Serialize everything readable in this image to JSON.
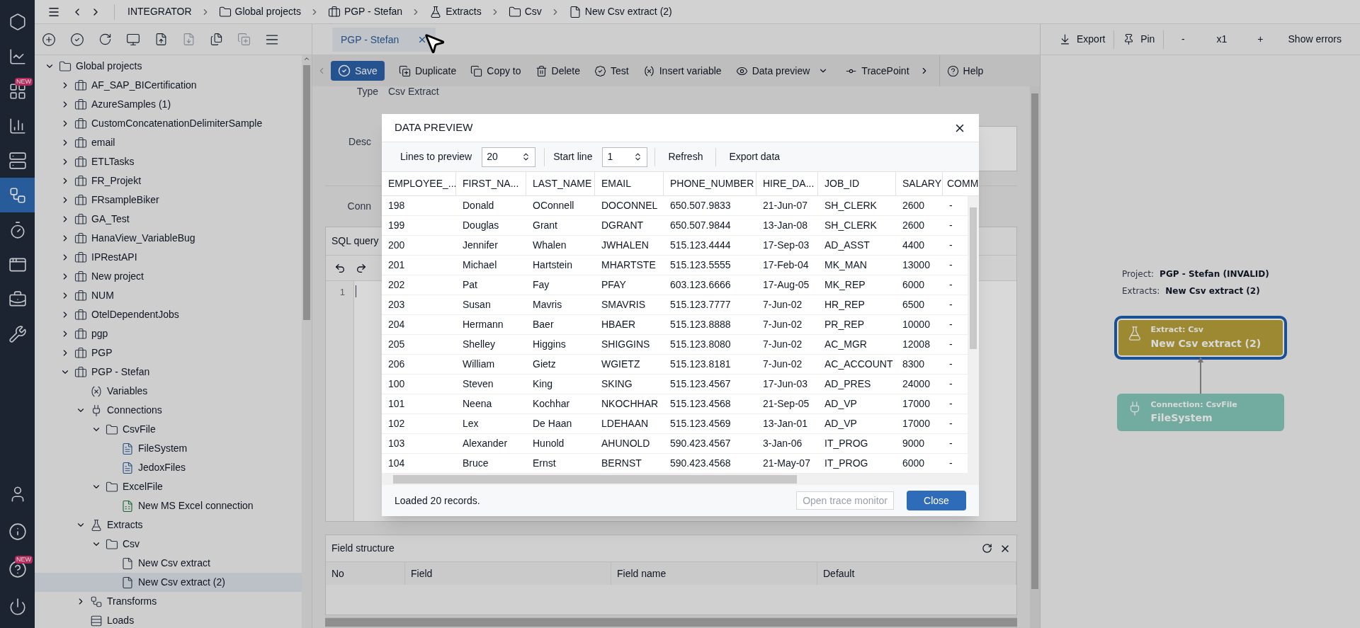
{
  "nav_rail": [
    {
      "selected": false
    },
    {
      "selected": false
    },
    {
      "selected": false,
      "badge": "NEW"
    },
    {
      "selected": false
    },
    {
      "selected": false
    },
    {
      "selected": true
    },
    {
      "selected": false
    },
    {
      "selected": false
    },
    {
      "selected": false
    },
    {
      "selected": false
    }
  ],
  "nav_rail_bottom": [
    {
      "selected": false
    },
    {
      "selected": false
    },
    {
      "selected": false,
      "badge": "NEW"
    },
    {
      "selected": false
    }
  ],
  "breadcrumb": [
    {
      "label": "INTEGRATOR",
      "kind": "root"
    },
    {
      "label": "Global projects",
      "kind": "folder"
    },
    {
      "label": "PGP - Stefan",
      "kind": "project"
    },
    {
      "label": "Extracts",
      "kind": "extracts"
    },
    {
      "label": "Csv",
      "kind": "folder"
    },
    {
      "label": "New Csv extract (2)",
      "kind": "file"
    }
  ],
  "tabs": [
    {
      "label": "PGP - Stefan",
      "selected": true
    }
  ],
  "editor_toolbar": [
    {
      "label": "Save",
      "kind": "save"
    },
    {
      "label": "Duplicate",
      "kind": "duplicate"
    },
    {
      "label": "Copy to",
      "kind": "copy"
    },
    {
      "label": "Delete",
      "kind": "delete"
    },
    {
      "label": "Test",
      "kind": "test"
    },
    {
      "label": "Insert variable",
      "kind": "variable"
    },
    {
      "label": "Data preview",
      "kind": "preview"
    },
    {
      "label": "TracePoint",
      "kind": "trace"
    },
    {
      "label": "Help",
      "kind": "help"
    }
  ],
  "graph_toolbar": [
    {
      "label": "Export",
      "kind": "export"
    },
    {
      "label": "Pin",
      "kind": "pin"
    },
    {
      "label": "-",
      "kind": "zoom"
    },
    {
      "label": "x1",
      "kind": "zoom"
    },
    {
      "label": "+",
      "kind": "zoom"
    },
    {
      "label": "Show errors",
      "kind": "plain"
    }
  ],
  "tree": [
    {
      "label": "Global projects",
      "kind": "folder",
      "expanded": true,
      "selected": false,
      "children": [
        {
          "label": "AF_SAP_BICertification",
          "kind": "project",
          "expanded": false,
          "selected": false
        },
        {
          "label": "AzureSamples (1)",
          "kind": "project",
          "expanded": false,
          "selected": false
        },
        {
          "label": "CustomConcatenationDelimiterSample",
          "kind": "project",
          "expanded": false,
          "selected": false
        },
        {
          "label": "email",
          "kind": "project",
          "expanded": false,
          "selected": false
        },
        {
          "label": "ETLTasks",
          "kind": "project",
          "expanded": false,
          "selected": false
        },
        {
          "label": "FR_Projekt",
          "kind": "project",
          "expanded": false,
          "selected": false
        },
        {
          "label": "FRsampleBiker",
          "kind": "project",
          "expanded": false,
          "selected": false
        },
        {
          "label": "GA_Test",
          "kind": "project",
          "expanded": false,
          "selected": false
        },
        {
          "label": "HanaView_VariableBug",
          "kind": "project",
          "expanded": false,
          "selected": false
        },
        {
          "label": "IPRestAPI",
          "kind": "project",
          "expanded": false,
          "selected": false
        },
        {
          "label": "New project",
          "kind": "project",
          "expanded": false,
          "selected": false
        },
        {
          "label": "NUM",
          "kind": "project",
          "expanded": false,
          "selected": false
        },
        {
          "label": "OtelDependentJobs",
          "kind": "project",
          "expanded": false,
          "selected": false
        },
        {
          "label": "pgp",
          "kind": "project",
          "expanded": false,
          "selected": false
        },
        {
          "label": "PGP",
          "kind": "project",
          "expanded": false,
          "selected": false
        },
        {
          "label": "PGP - Stefan",
          "kind": "project",
          "expanded": true,
          "selected": false,
          "children": [
            {
              "label": "Variables",
              "kind": "variables",
              "selected": false
            },
            {
              "label": "Connections",
              "kind": "connections",
              "expanded": true,
              "selected": false,
              "children": [
                {
                  "label": "CsvFile",
                  "kind": "folder",
                  "expanded": true,
                  "selected": false,
                  "children": [
                    {
                      "label": "FileSystem",
                      "kind": "csv",
                      "selected": false
                    },
                    {
                      "label": "JedoxFiles",
                      "kind": "csv",
                      "selected": false
                    }
                  ]
                },
                {
                  "label": "ExcelFile",
                  "kind": "folder",
                  "expanded": true,
                  "selected": false,
                  "children": [
                    {
                      "label": "New MS Excel connection",
                      "kind": "excel",
                      "selected": false
                    }
                  ]
                }
              ]
            },
            {
              "label": "Extracts",
              "kind": "extracts",
              "expanded": true,
              "selected": false,
              "children": [
                {
                  "label": "Csv",
                  "kind": "folder",
                  "expanded": true,
                  "selected": false,
                  "children": [
                    {
                      "label": "New Csv extract",
                      "kind": "file",
                      "selected": false
                    },
                    {
                      "label": "New Csv extract (2)",
                      "kind": "file",
                      "selected": true
                    }
                  ]
                }
              ]
            },
            {
              "label": "Transforms",
              "kind": "transforms",
              "expanded": false,
              "selected": false
            },
            {
              "label": "Loads",
              "kind": "loads",
              "selected": false
            }
          ]
        }
      ]
    }
  ],
  "form": {
    "type_label": "Type",
    "type_value": "Csv Extract",
    "description_label": "Desc",
    "connection_label": "Conn"
  },
  "sql_query": {
    "title": "SQL query",
    "line_numbers": [
      "1"
    ]
  },
  "field_structure": {
    "title": "Field structure",
    "columns": [
      "No",
      "Field",
      "Field name",
      "Default"
    ]
  },
  "graph": {
    "project_label": "Project:",
    "project_value": "PGP - Stefan (INVALID)",
    "extracts_label": "Extracts:",
    "extracts_value": "New Csv extract (2)",
    "nodes": [
      {
        "kind": "extract",
        "caption": "Extract: Csv",
        "name": "New Csv extract (2)",
        "selected": true
      },
      {
        "kind": "connection",
        "caption": "Connection: CsvFile",
        "name": "FileSystem",
        "selected": false
      }
    ]
  },
  "dialog": {
    "title": "DATA PREVIEW",
    "lines_label": "Lines to preview",
    "lines_value": "20",
    "start_label": "Start line",
    "start_value": "1",
    "refresh": "Refresh",
    "export": "Export data",
    "columns": [
      "EMPLOYEE_...",
      "FIRST_NA...",
      "LAST_NAME",
      "EMAIL",
      "PHONE_NUMBER",
      "HIRE_DA...",
      "JOB_ID",
      "SALARY",
      "COMM"
    ],
    "rows": [
      [
        "198",
        "Donald",
        "OConnell",
        "DOCONNEL",
        "650.507.9833",
        "21-Jun-07",
        "SH_CLERK",
        "2600",
        "-"
      ],
      [
        "199",
        "Douglas",
        "Grant",
        "DGRANT",
        "650.507.9844",
        "13-Jan-08",
        "SH_CLERK",
        "2600",
        "-"
      ],
      [
        "200",
        "Jennifer",
        "Whalen",
        "JWHALEN",
        "515.123.4444",
        "17-Sep-03",
        "AD_ASST",
        "4400",
        "-"
      ],
      [
        "201",
        "Michael",
        "Hartstein",
        "MHARTSTE",
        "515.123.5555",
        "17-Feb-04",
        "MK_MAN",
        "13000",
        "-"
      ],
      [
        "202",
        "Pat",
        "Fay",
        "PFAY",
        "603.123.6666",
        "17-Aug-05",
        "MK_REP",
        "6000",
        "-"
      ],
      [
        "203",
        "Susan",
        "Mavris",
        "SMAVRIS",
        "515.123.7777",
        "7-Jun-02",
        "HR_REP",
        "6500",
        "-"
      ],
      [
        "204",
        "Hermann",
        "Baer",
        "HBAER",
        "515.123.8888",
        "7-Jun-02",
        "PR_REP",
        "10000",
        "-"
      ],
      [
        "205",
        "Shelley",
        "Higgins",
        "SHIGGINS",
        "515.123.8080",
        "7-Jun-02",
        "AC_MGR",
        "12008",
        "-"
      ],
      [
        "206",
        "William",
        "Gietz",
        "WGIETZ",
        "515.123.8181",
        "7-Jun-02",
        "AC_ACCOUNT",
        "8300",
        "-"
      ],
      [
        "100",
        "Steven",
        "King",
        "SKING",
        "515.123.4567",
        "17-Jun-03",
        "AD_PRES",
        "24000",
        "-"
      ],
      [
        "101",
        "Neena",
        "Kochhar",
        "NKOCHHAR",
        "515.123.4568",
        "21-Sep-05",
        "AD_VP",
        "17000",
        "-"
      ],
      [
        "102",
        "Lex",
        "De Haan",
        "LDEHAAN",
        "515.123.4569",
        "13-Jan-01",
        "AD_VP",
        "17000",
        "-"
      ],
      [
        "103",
        "Alexander",
        "Hunold",
        "AHUNOLD",
        "590.423.4567",
        "3-Jan-06",
        "IT_PROG",
        "9000",
        "-"
      ],
      [
        "104",
        "Bruce",
        "Ernst",
        "BERNST",
        "590.423.4568",
        "21-May-07",
        "IT_PROG",
        "6000",
        "-"
      ]
    ],
    "status": "Loaded 20 records.",
    "secondary_button": "Open trace monitor",
    "primary_button": "Close"
  }
}
